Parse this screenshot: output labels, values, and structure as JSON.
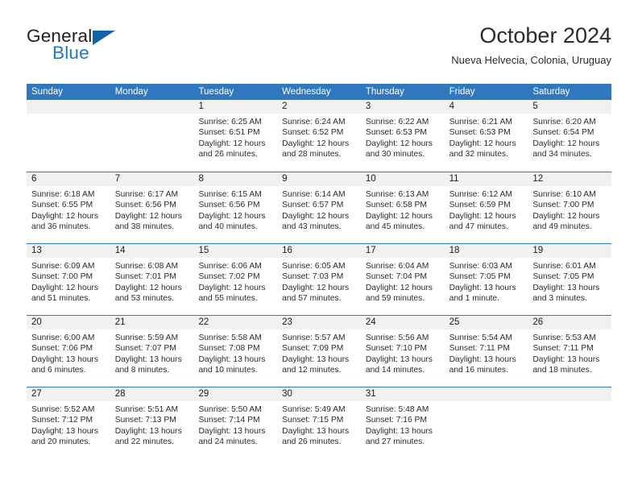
{
  "brand": {
    "name_part1": "General",
    "name_part2": "Blue"
  },
  "header": {
    "title": "October 2024",
    "subtitle": "Nueva Helvecia, Colonia, Uruguay"
  },
  "colors": {
    "header_blue": "#2f78bf",
    "daynum_band": "#f1f1f1",
    "brand_blue": "#2277c8",
    "text": "#2b2b2b"
  },
  "weekdays": [
    "Sunday",
    "Monday",
    "Tuesday",
    "Wednesday",
    "Thursday",
    "Friday",
    "Saturday"
  ],
  "labels": {
    "sunrise_prefix": "Sunrise:",
    "sunset_prefix": "Sunset:",
    "daylight_prefix": "Daylight:"
  },
  "weeks": [
    [
      {
        "day": "",
        "empty": true
      },
      {
        "day": "",
        "empty": true
      },
      {
        "day": "1",
        "sunrise": "Sunrise: 6:25 AM",
        "sunset": "Sunset: 6:51 PM",
        "daylight": "Daylight: 12 hours and 26 minutes."
      },
      {
        "day": "2",
        "sunrise": "Sunrise: 6:24 AM",
        "sunset": "Sunset: 6:52 PM",
        "daylight": "Daylight: 12 hours and 28 minutes."
      },
      {
        "day": "3",
        "sunrise": "Sunrise: 6:22 AM",
        "sunset": "Sunset: 6:53 PM",
        "daylight": "Daylight: 12 hours and 30 minutes."
      },
      {
        "day": "4",
        "sunrise": "Sunrise: 6:21 AM",
        "sunset": "Sunset: 6:53 PM",
        "daylight": "Daylight: 12 hours and 32 minutes."
      },
      {
        "day": "5",
        "sunrise": "Sunrise: 6:20 AM",
        "sunset": "Sunset: 6:54 PM",
        "daylight": "Daylight: 12 hours and 34 minutes."
      }
    ],
    [
      {
        "day": "6",
        "sunrise": "Sunrise: 6:18 AM",
        "sunset": "Sunset: 6:55 PM",
        "daylight": "Daylight: 12 hours and 36 minutes."
      },
      {
        "day": "7",
        "sunrise": "Sunrise: 6:17 AM",
        "sunset": "Sunset: 6:56 PM",
        "daylight": "Daylight: 12 hours and 38 minutes."
      },
      {
        "day": "8",
        "sunrise": "Sunrise: 6:15 AM",
        "sunset": "Sunset: 6:56 PM",
        "daylight": "Daylight: 12 hours and 40 minutes."
      },
      {
        "day": "9",
        "sunrise": "Sunrise: 6:14 AM",
        "sunset": "Sunset: 6:57 PM",
        "daylight": "Daylight: 12 hours and 43 minutes."
      },
      {
        "day": "10",
        "sunrise": "Sunrise: 6:13 AM",
        "sunset": "Sunset: 6:58 PM",
        "daylight": "Daylight: 12 hours and 45 minutes."
      },
      {
        "day": "11",
        "sunrise": "Sunrise: 6:12 AM",
        "sunset": "Sunset: 6:59 PM",
        "daylight": "Daylight: 12 hours and 47 minutes."
      },
      {
        "day": "12",
        "sunrise": "Sunrise: 6:10 AM",
        "sunset": "Sunset: 7:00 PM",
        "daylight": "Daylight: 12 hours and 49 minutes."
      }
    ],
    [
      {
        "day": "13",
        "sunrise": "Sunrise: 6:09 AM",
        "sunset": "Sunset: 7:00 PM",
        "daylight": "Daylight: 12 hours and 51 minutes."
      },
      {
        "day": "14",
        "sunrise": "Sunrise: 6:08 AM",
        "sunset": "Sunset: 7:01 PM",
        "daylight": "Daylight: 12 hours and 53 minutes."
      },
      {
        "day": "15",
        "sunrise": "Sunrise: 6:06 AM",
        "sunset": "Sunset: 7:02 PM",
        "daylight": "Daylight: 12 hours and 55 minutes."
      },
      {
        "day": "16",
        "sunrise": "Sunrise: 6:05 AM",
        "sunset": "Sunset: 7:03 PM",
        "daylight": "Daylight: 12 hours and 57 minutes."
      },
      {
        "day": "17",
        "sunrise": "Sunrise: 6:04 AM",
        "sunset": "Sunset: 7:04 PM",
        "daylight": "Daylight: 12 hours and 59 minutes."
      },
      {
        "day": "18",
        "sunrise": "Sunrise: 6:03 AM",
        "sunset": "Sunset: 7:05 PM",
        "daylight": "Daylight: 13 hours and 1 minute."
      },
      {
        "day": "19",
        "sunrise": "Sunrise: 6:01 AM",
        "sunset": "Sunset: 7:05 PM",
        "daylight": "Daylight: 13 hours and 3 minutes."
      }
    ],
    [
      {
        "day": "20",
        "sunrise": "Sunrise: 6:00 AM",
        "sunset": "Sunset: 7:06 PM",
        "daylight": "Daylight: 13 hours and 6 minutes."
      },
      {
        "day": "21",
        "sunrise": "Sunrise: 5:59 AM",
        "sunset": "Sunset: 7:07 PM",
        "daylight": "Daylight: 13 hours and 8 minutes."
      },
      {
        "day": "22",
        "sunrise": "Sunrise: 5:58 AM",
        "sunset": "Sunset: 7:08 PM",
        "daylight": "Daylight: 13 hours and 10 minutes."
      },
      {
        "day": "23",
        "sunrise": "Sunrise: 5:57 AM",
        "sunset": "Sunset: 7:09 PM",
        "daylight": "Daylight: 13 hours and 12 minutes."
      },
      {
        "day": "24",
        "sunrise": "Sunrise: 5:56 AM",
        "sunset": "Sunset: 7:10 PM",
        "daylight": "Daylight: 13 hours and 14 minutes."
      },
      {
        "day": "25",
        "sunrise": "Sunrise: 5:54 AM",
        "sunset": "Sunset: 7:11 PM",
        "daylight": "Daylight: 13 hours and 16 minutes."
      },
      {
        "day": "26",
        "sunrise": "Sunrise: 5:53 AM",
        "sunset": "Sunset: 7:11 PM",
        "daylight": "Daylight: 13 hours and 18 minutes."
      }
    ],
    [
      {
        "day": "27",
        "sunrise": "Sunrise: 5:52 AM",
        "sunset": "Sunset: 7:12 PM",
        "daylight": "Daylight: 13 hours and 20 minutes."
      },
      {
        "day": "28",
        "sunrise": "Sunrise: 5:51 AM",
        "sunset": "Sunset: 7:13 PM",
        "daylight": "Daylight: 13 hours and 22 minutes."
      },
      {
        "day": "29",
        "sunrise": "Sunrise: 5:50 AM",
        "sunset": "Sunset: 7:14 PM",
        "daylight": "Daylight: 13 hours and 24 minutes."
      },
      {
        "day": "30",
        "sunrise": "Sunrise: 5:49 AM",
        "sunset": "Sunset: 7:15 PM",
        "daylight": "Daylight: 13 hours and 26 minutes."
      },
      {
        "day": "31",
        "sunrise": "Sunrise: 5:48 AM",
        "sunset": "Sunset: 7:16 PM",
        "daylight": "Daylight: 13 hours and 27 minutes."
      },
      {
        "day": "",
        "empty": true
      },
      {
        "day": "",
        "empty": true
      }
    ]
  ]
}
